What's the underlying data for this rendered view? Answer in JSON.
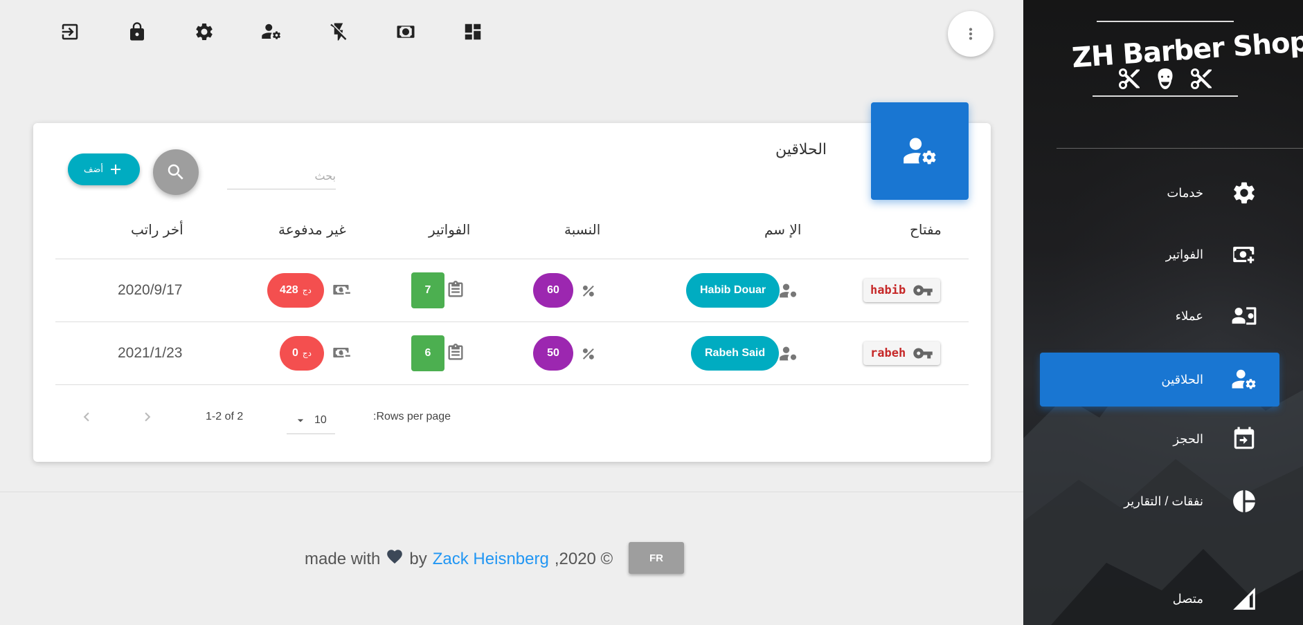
{
  "toolbar": {
    "icons": [
      "logout-icon",
      "lock-icon",
      "gear-icon",
      "user-settings-icon",
      "flash-off-icon",
      "money-icon",
      "dashboard-icon"
    ]
  },
  "menu": {
    "icon": "more-vert-icon"
  },
  "card": {
    "title": "الحلاقين",
    "icon": "barber-settings-icon",
    "search_placeholder": "بحث",
    "add_label": "أضف"
  },
  "table": {
    "headers": {
      "key": "مفتاح",
      "name": "الإ سم",
      "percent": "النسبة",
      "invoices": "الفواتير",
      "unpaid": "غير مدفوعة",
      "last_salary": "أخر راتب"
    },
    "rows": [
      {
        "key": "habib",
        "name": "Habib Douar",
        "percent": "60",
        "invoices": "7",
        "unpaid": "428",
        "currency": "دج",
        "last_salary": "2020/9/17"
      },
      {
        "key": "rabeh",
        "name": "Rabeh Said",
        "percent": "50",
        "invoices": "6",
        "unpaid": "0",
        "currency": "دج",
        "last_salary": "2021/1/23"
      }
    ]
  },
  "pagination": {
    "rows_per_page_label": ":Rows per page",
    "rows_per_page_value": "10",
    "range": "1-2 of 2"
  },
  "footer": {
    "made_with": "made with",
    "by": "by",
    "author": "Zack Heisnberg",
    "year": ",2020 ©",
    "lang_button": "FR"
  },
  "sidebar": {
    "brand": "ZH Barber Shop",
    "items": [
      {
        "label": "خدمات",
        "icon": "gear-icon",
        "active": false
      },
      {
        "label": "الفواتير",
        "icon": "add-money-icon",
        "active": false
      },
      {
        "label": "عملاء",
        "icon": "clients-icon",
        "active": false
      },
      {
        "label": "الحلاقين",
        "icon": "barber-settings-icon",
        "active": true
      },
      {
        "label": "الحجز",
        "icon": "calendar-icon",
        "active": false
      },
      {
        "label": "نفقات / التقارير",
        "icon": "pie-chart-icon",
        "active": false
      },
      {
        "label": "متصل",
        "icon": "signal-icon",
        "active": false
      }
    ]
  },
  "colors": {
    "primary": "#1976d2",
    "cyan": "#00acc1",
    "purple": "#9c27b0",
    "green": "#4caf50",
    "red": "#f44f4f",
    "grey": "#9e9e9e"
  }
}
